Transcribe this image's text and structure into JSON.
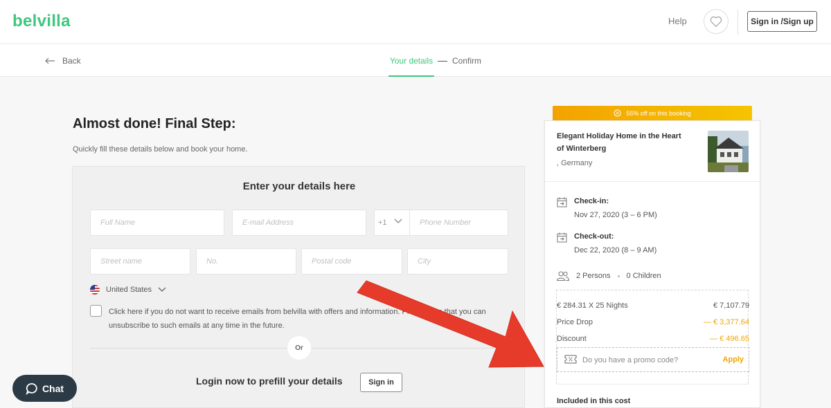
{
  "header": {
    "logo": "belvilla",
    "help": "Help",
    "signin": "Sign in /Sign up"
  },
  "steps": {
    "back": "Back",
    "active": "Your details",
    "confirm": "Confirm"
  },
  "main": {
    "title": "Almost done! Final Step:",
    "subtitle": "Quickly fill these details below and book your home.",
    "form_title": "Enter your details here",
    "placeholders": {
      "full_name": "Full Name",
      "email": "E-mail Address",
      "phone": "Phone Number",
      "street": "Street name",
      "number": "No.",
      "postal": "Postal code",
      "city": "City"
    },
    "phone_code": "+1",
    "country": "United States",
    "consent": "Click here if you do not want to receive emails from belvilla with offers and information. Please note that you can unsubscribe to such emails at any time in the future.",
    "or": "Or",
    "login_text": "Login now to prefill your details",
    "login_button": "Sign in"
  },
  "sidebar": {
    "banner": "55% off on this booking",
    "property_title": "Elegant Holiday Home in the Heart of Winterberg",
    "location": ", Germany",
    "checkin_label": "Check-in:",
    "checkin_value": "Nov 27, 2020 (3 – 6 PM)",
    "checkout_label": "Check-out:",
    "checkout_value": "Dec 22, 2020 (8 – 9 AM)",
    "persons": "2 Persons",
    "children": "0 Children",
    "price_rows": [
      {
        "label": "€ 284.31 X 25 Nights",
        "amount": "€ 7,107.79"
      },
      {
        "label": "Price Drop",
        "amount": "— € 3,377.64"
      },
      {
        "label": "Discount",
        "amount": "— € 496.65"
      }
    ],
    "promo_placeholder": "Do you have a promo code?",
    "apply": "Apply",
    "included": "Included in this cost"
  },
  "chat": {
    "label": "Chat"
  },
  "colors": {
    "brand": "#3fc77d",
    "accent": "#f0a500",
    "annotation": "#e63b2a"
  },
  "icons": [
    "heart-icon",
    "back-arrow-icon",
    "flag-icon",
    "calendar-icon",
    "people-icon",
    "ticket-icon",
    "discount-icon",
    "chat-bubble-icon"
  ]
}
